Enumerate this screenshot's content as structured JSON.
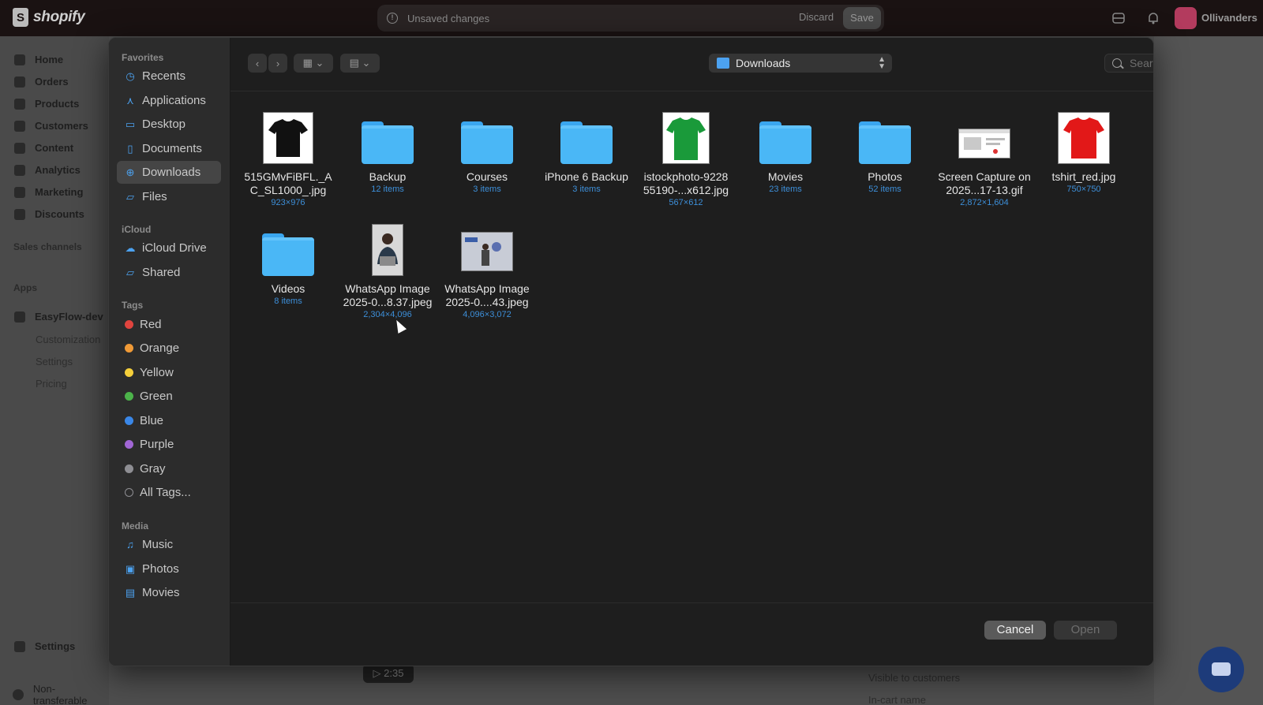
{
  "shopify": {
    "logo_text": "shopify",
    "unsaved_text": "Unsaved changes",
    "discard_label": "Discard",
    "save_label": "Save",
    "store_name": "Ollivanders",
    "nav": [
      "Home",
      "Orders",
      "Products",
      "Customers",
      "Content",
      "Analytics",
      "Marketing",
      "Discounts"
    ],
    "sales_channels": "Sales channels",
    "apps_heading": "Apps",
    "app_name": "EasyFlow-dev",
    "app_sub": [
      "Customization",
      "Settings",
      "Pricing"
    ],
    "settings_label": "Settings",
    "non_transferable": "Non-transferable",
    "visible_to_customers": "Visible to customers",
    "in_cart_name": "In-cart name",
    "video_time": "2:35"
  },
  "dialog": {
    "location": "Downloads",
    "search_placeholder": "Search",
    "sidebar": {
      "favorites_heading": "Favorites",
      "favorites": [
        "Recents",
        "Applications",
        "Desktop",
        "Documents",
        "Downloads",
        "Files"
      ],
      "icloud_heading": "iCloud",
      "icloud": [
        "iCloud Drive",
        "Shared"
      ],
      "tags_heading": "Tags",
      "tags": [
        {
          "label": "Red",
          "color": "#e0443e"
        },
        {
          "label": "Orange",
          "color": "#f09a37"
        },
        {
          "label": "Yellow",
          "color": "#f5cf3b"
        },
        {
          "label": "Green",
          "color": "#4cb34a"
        },
        {
          "label": "Blue",
          "color": "#3a87e8"
        },
        {
          "label": "Purple",
          "color": "#a166d5"
        },
        {
          "label": "Gray",
          "color": "#8e8e93"
        },
        {
          "label": "All Tags...",
          "color": ""
        }
      ],
      "media_heading": "Media",
      "media": [
        "Music",
        "Photos",
        "Movies"
      ]
    },
    "files": [
      {
        "name": "515GMvFiBFL._A C_SL1000_.jpg",
        "meta": "923×976",
        "kind": "image",
        "icon": "black-tshirt"
      },
      {
        "name": "Backup",
        "meta": "12 items",
        "kind": "folder"
      },
      {
        "name": "Courses",
        "meta": "3 items",
        "kind": "folder"
      },
      {
        "name": "iPhone 6 Backup",
        "meta": "3 items",
        "kind": "folder"
      },
      {
        "name": "istockphoto-9228 55190-...x612.jpg",
        "meta": "567×612",
        "kind": "image",
        "icon": "green-tshirt"
      },
      {
        "name": "Movies",
        "meta": "23 items",
        "kind": "folder"
      },
      {
        "name": "Photos",
        "meta": "52 items",
        "kind": "folder"
      },
      {
        "name": "Screen Capture on 2025...17-13.gif",
        "meta": "2,872×1,604",
        "kind": "image",
        "icon": "screenshot"
      },
      {
        "name": "tshirt_red.jpg",
        "meta": "750×750",
        "kind": "image",
        "icon": "red-tshirt"
      },
      {
        "name": "Videos",
        "meta": "8 items",
        "kind": "folder"
      },
      {
        "name": "WhatsApp Image 2025-0...8.37.jpeg",
        "meta": "2,304×4,096",
        "kind": "image",
        "icon": "portrait-photo"
      },
      {
        "name": "WhatsApp Image 2025-0....43.jpeg",
        "meta": "4,096×3,072",
        "kind": "image",
        "icon": "landscape-photo"
      }
    ],
    "cancel_label": "Cancel",
    "open_label": "Open"
  }
}
